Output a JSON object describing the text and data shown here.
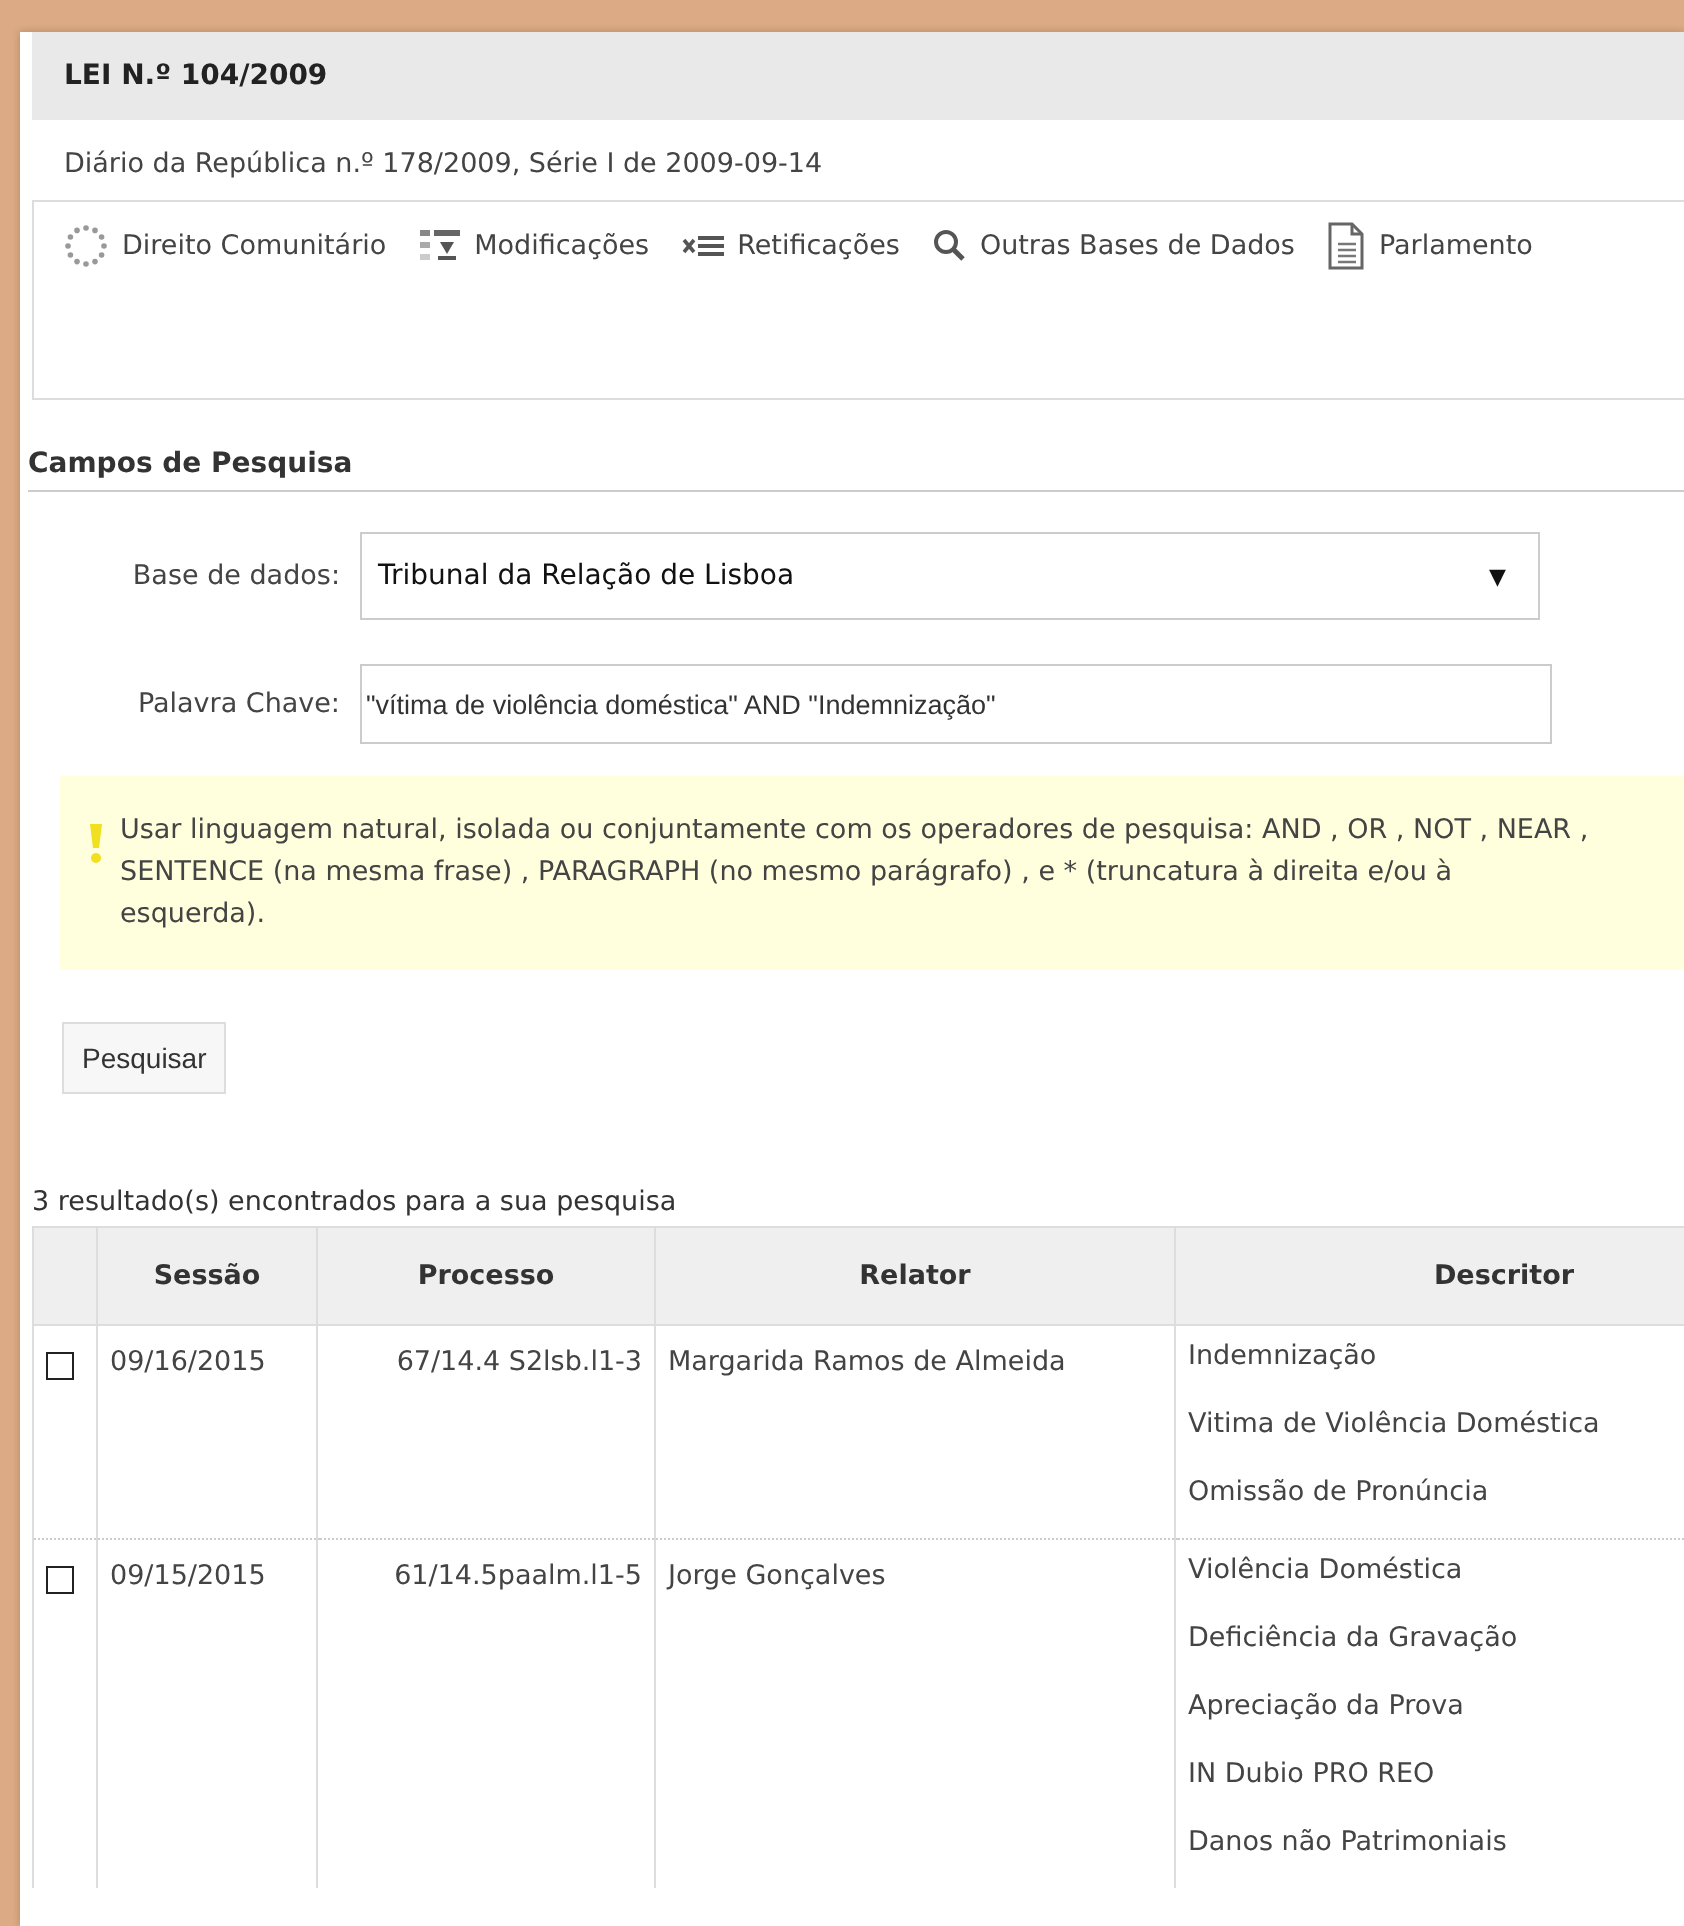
{
  "header": {
    "title": "LEI N.º 104/2009",
    "subtitle": "Diário da República n.º 178/2009, Série I de 2009-09-14"
  },
  "toolbar": [
    {
      "kind": "eu",
      "label": "Direito Comunitário"
    },
    {
      "kind": "changes",
      "label": "Modificações"
    },
    {
      "kind": "corrections",
      "label": "Retificações"
    },
    {
      "kind": "search",
      "label": "Outras Bases de Dados"
    },
    {
      "kind": "document",
      "label": "Parlamento"
    }
  ],
  "search_form": {
    "heading": "Campos de Pesquisa",
    "database_label": "Base de dados:",
    "database_value": "Tribunal da Relação de Lisboa",
    "dropdown_arrow": "▼",
    "keyword_label": "Palavra Chave:",
    "keyword_value": "\"vítima de violência doméstica\" AND \"Indemnização\"",
    "notice": "Usar linguagem natural, isolada ou conjuntamente com os operadores de pesquisa: AND , OR , NOT , NEAR , SENTENCE (na mesma frase) , PARAGRAPH (no mesmo parágrafo) , e * (truncatura à direita e/ou à esquerda).",
    "button": "Pesquisar"
  },
  "results": {
    "summary": "3 resultado(s) encontrados para a sua pesquisa",
    "columns": [
      "Sessão",
      "Processo",
      "Relator",
      "Descritor"
    ],
    "rows": [
      {
        "checked": false,
        "session": "09/16/2015",
        "process": "67/14.4 S2lsb.l1-3",
        "rapporteur": "Margarida Ramos de Almeida",
        "descriptors": [
          "Indemnização",
          "Vitima de Violência Doméstica",
          "Omissão de Pronúncia"
        ]
      },
      {
        "checked": false,
        "session": "09/15/2015",
        "process": "61/14.5paalm.l1-5",
        "rapporteur": "Jorge Gonçalves",
        "descriptors": [
          "Violência Doméstica",
          "Deficiência da Gravação",
          "Apreciação da Prova",
          "IN Dubio PRO REO",
          "Danos não Patrimoniais"
        ]
      }
    ]
  }
}
